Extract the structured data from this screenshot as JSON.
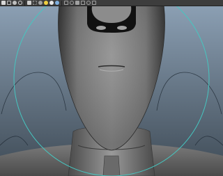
{
  "viewport": {
    "background_top": "#8b9fb3",
    "background_bottom": "#3e4a55",
    "selection_color": "#46c6c0"
  },
  "toolbar": {
    "icons": [
      {
        "name": "select-tool-icon",
        "color": "#d8d8d8"
      },
      {
        "name": "lasso-tool-icon",
        "color": "#bfbfbf"
      },
      {
        "name": "paint-tool-icon",
        "color": "#bfbfbf"
      },
      {
        "name": "move-tool-icon",
        "color": "#cfcfcf"
      },
      {
        "name": "rotate-tool-icon",
        "color": "#cfcfcf"
      },
      {
        "name": "grid-toggle-icon",
        "color": "#a0a0a0"
      },
      {
        "name": "camera-icon",
        "color": "#a0a0a0"
      },
      {
        "name": "light-icon",
        "color": "#f0d040"
      },
      {
        "name": "shading-icon",
        "color": "#e8e8e8"
      },
      {
        "name": "texture-icon",
        "color": "#7fb0e0"
      },
      {
        "name": "render-icon",
        "color": "#a0a0a0"
      },
      {
        "name": "isolate-icon",
        "color": "#a0a0a0"
      },
      {
        "name": "xray-icon",
        "color": "#a0a0a0"
      },
      {
        "name": "wireframe-icon",
        "color": "#a0a0a0"
      },
      {
        "name": "resolution-gate-icon",
        "color": "#a0a0a0"
      },
      {
        "name": "film-gate-icon",
        "color": "#a0a0a0"
      }
    ]
  }
}
